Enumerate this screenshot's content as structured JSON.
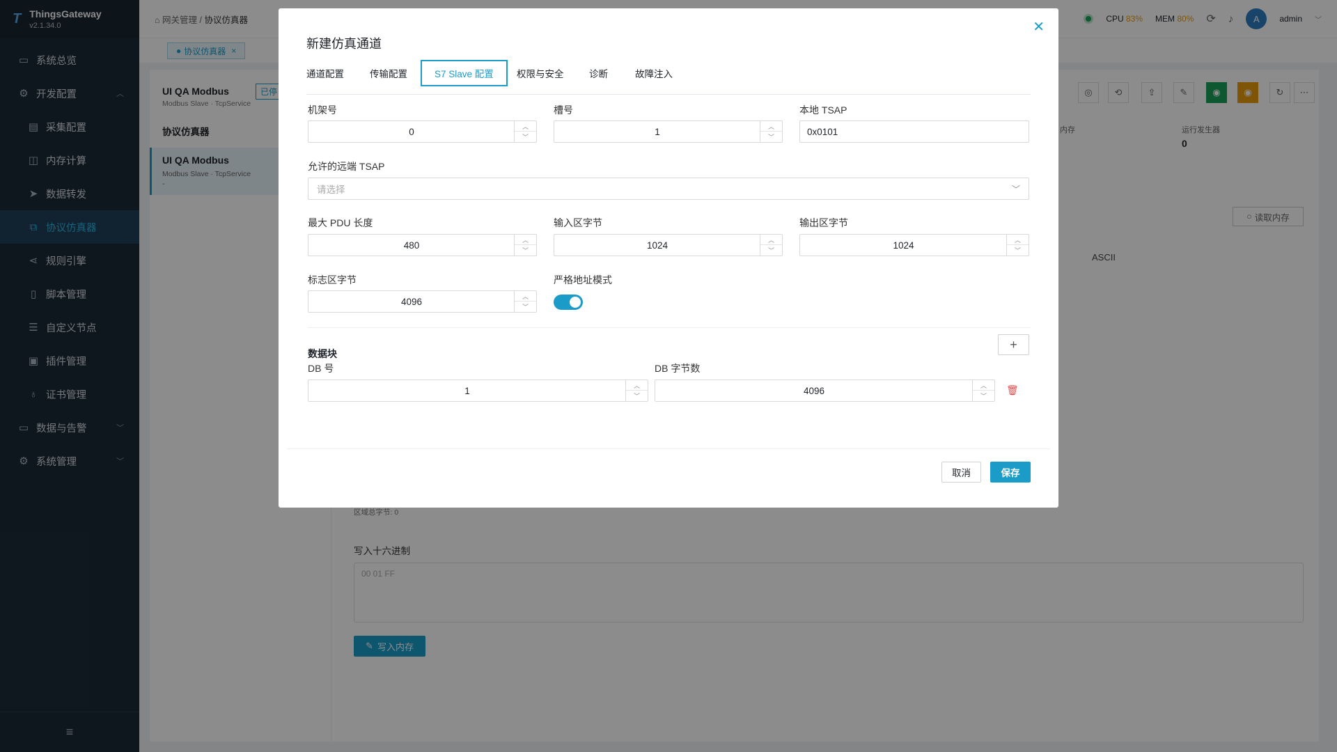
{
  "app": {
    "name": "ThingsGateway",
    "version": "v2.1.34.0"
  },
  "sidebar": {
    "items": [
      {
        "label": "系统总览"
      },
      {
        "label": "开发配置"
      },
      {
        "label": "采集配置"
      },
      {
        "label": "内存计算"
      },
      {
        "label": "数据转发"
      },
      {
        "label": "协议仿真器"
      },
      {
        "label": "规则引擎"
      },
      {
        "label": "脚本管理"
      },
      {
        "label": "自定义节点"
      },
      {
        "label": "插件管理"
      },
      {
        "label": "证书管理"
      },
      {
        "label": "数据与告警"
      },
      {
        "label": "系统管理"
      }
    ]
  },
  "header": {
    "breadcrumb_root": "网关管理",
    "breadcrumb_sep": "/",
    "breadcrumb_current": "协议仿真器",
    "cpu_label": "CPU",
    "cpu_value": "83%",
    "mem_label": "MEM",
    "mem_value": "80%",
    "avatar_letter": "A",
    "user": "admin"
  },
  "page_tab": {
    "label": "协议仿真器"
  },
  "left_panel": {
    "title": "UI QA Modbus",
    "subtitle": "Modbus Slave · TcpService",
    "status_badge": "已停",
    "section_title": "协议仿真器",
    "item_title": "UI QA Modbus",
    "item_sub": "Modbus Slave · TcpService",
    "item_extra": "-"
  },
  "background": {
    "stat1_label": "内存",
    "stat2_label": "运行发生器",
    "stat2_value": "0",
    "read_button": "读取内存",
    "ascii_header": "ASCII",
    "total_bytes": "区域总字节: 0",
    "write_hex_label": "写入十六进制",
    "write_hex_placeholder": "00 01 FF",
    "write_button": "写入内存"
  },
  "modal": {
    "title": "新建仿真通道",
    "tabs": [
      "通道配置",
      "传输配置",
      "S7 Slave 配置",
      "权限与安全",
      "诊断",
      "故障注入"
    ],
    "fields": {
      "rack_label": "机架号",
      "rack_value": "0",
      "slot_label": "槽号",
      "slot_value": "1",
      "local_tsap_label": "本地 TSAP",
      "local_tsap_value": "0x0101",
      "remote_tsap_label": "允许的远端 TSAP",
      "remote_tsap_placeholder": "请选择",
      "max_pdu_label": "最大 PDU 长度",
      "max_pdu_value": "480",
      "input_bytes_label": "输入区字节",
      "input_bytes_value": "1024",
      "output_bytes_label": "输出区字节",
      "output_bytes_value": "1024",
      "flag_bytes_label": "标志区字节",
      "flag_bytes_value": "4096",
      "strict_mode_label": "严格地址模式",
      "strict_mode_on": true
    },
    "data_block": {
      "section_title": "数据块",
      "db_no_label": "DB 号",
      "db_no_value": "1",
      "db_bytes_label": "DB 字节数",
      "db_bytes_value": "4096"
    },
    "cancel_label": "取消",
    "save_label": "保存"
  },
  "colors": {
    "accent": "#1b9cc8",
    "sidebar_bg": "#1c2a38",
    "danger": "#e04a4a",
    "warn": "#e89b10"
  }
}
